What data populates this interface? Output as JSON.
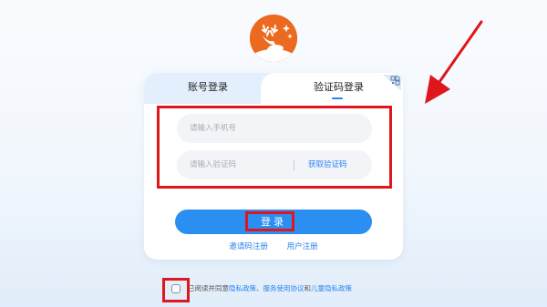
{
  "login": {
    "tabs": [
      {
        "label": "账号登录",
        "active": false
      },
      {
        "label": "验证码登录",
        "active": true
      }
    ],
    "phone_placeholder": "请输入手机号",
    "code_placeholder": "请输入验证码",
    "get_code_label": "获取验证码",
    "submit_label": "登录",
    "invite_register_label": "邀请码注册",
    "user_register_label": "用户注册"
  },
  "agreement": {
    "checked": false,
    "prefix": "已阅读并同意",
    "privacy_policy": "隐私政策",
    "sep1": "、",
    "service_agreement": "服务使用协议",
    "conj": "和",
    "child_privacy_policy": "儿童隐私政策"
  },
  "icons": {
    "logo": "deer-logo-icon",
    "qr": "qr-code-icon"
  },
  "colors": {
    "accent": "#2b8ff2",
    "link": "#2a84f0",
    "logo_bg": "#ec6a1f",
    "annotation": "#e0161d"
  }
}
